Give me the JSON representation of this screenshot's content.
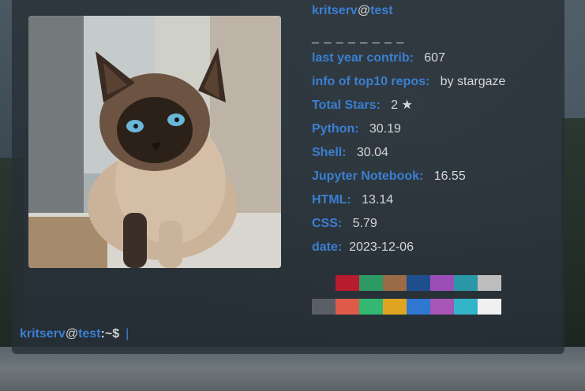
{
  "header": {
    "user": "kritserv",
    "at": "@",
    "host": "test",
    "separator": "_ _ _ _ _ _ _ _"
  },
  "stats": [
    {
      "key": "last year contrib:",
      "value": "607"
    },
    {
      "key": "info of top10 repos:",
      "value": "by stargaze"
    },
    {
      "key": "Total Stars:",
      "value": "2 ★"
    },
    {
      "key": "Python:",
      "value": "30.19"
    },
    {
      "key": "Shell:",
      "value": "30.04"
    },
    {
      "key": "Jupyter Notebook:",
      "value": "16.55"
    },
    {
      "key": "HTML:",
      "value": "13.14"
    },
    {
      "key": "CSS:",
      "value": "5.79"
    },
    {
      "key": "date:",
      "value": "2023-12-06"
    }
  ],
  "palette": {
    "row1": [
      "#2a3138",
      "#b71c2c",
      "#2c9a62",
      "#9a6b45",
      "#1f4e8c",
      "#9b4fb6",
      "#2a97a6",
      "#bdbdbd"
    ],
    "row2": [
      "#5a5f66",
      "#e05a4a",
      "#33b772",
      "#e0a520",
      "#2f78d0",
      "#a855b8",
      "#33b5c9",
      "#f0f0f0"
    ]
  },
  "prompt": {
    "user": "kritserv",
    "at": "@",
    "host": "test",
    "path": ":~$",
    "cursor": "|"
  },
  "photo": {
    "subject-icon": "siamese-cat-photo"
  }
}
